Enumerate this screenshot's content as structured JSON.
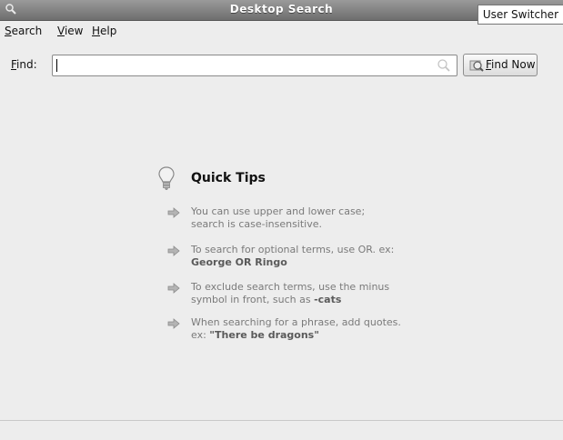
{
  "window": {
    "title": "Desktop Search",
    "title_icon": "magnifier-icon"
  },
  "user_switcher": "User Switcher",
  "menu": {
    "items": [
      {
        "label": "Search"
      },
      {
        "label": "View"
      },
      {
        "label": "Help"
      }
    ]
  },
  "find": {
    "label": "Find:",
    "value": "",
    "clear_icon": "search-clear-icon",
    "button_label": "Find Now",
    "button_icon": "find-now-icon"
  },
  "quick_tips": {
    "icon": "lightbulb-icon",
    "title": "Quick Tips",
    "tips": [
      {
        "line1": "You can use upper and lower case;",
        "line2": "search is case-insensitive."
      },
      {
        "line1": "To search for optional terms, use OR.  ex:",
        "emphasis": "George OR Ringo"
      },
      {
        "line1": "To exclude search terms, use the minus",
        "line2_prefix": "symbol in front, such as ",
        "emphasis": "-cats"
      },
      {
        "line1": "When searching for a phrase, add quotes.",
        "line2_prefix": "ex: ",
        "emphasis": "\"There be dragons\""
      }
    ]
  },
  "colors": {
    "titlebar": "#7a7a7a",
    "background": "#ededed",
    "tip_text": "#7a7a7a"
  }
}
